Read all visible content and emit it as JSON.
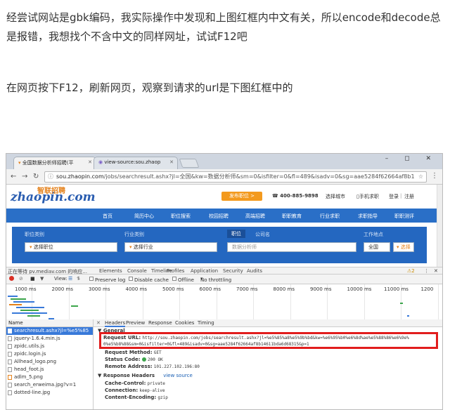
{
  "article": {
    "para1": "经尝试网站是gbk编码，我实际操作中发现和上图红框内中文有关，所以encode和decode总是报错，我想找个不含中文的同样网址，试试F12吧",
    "para2": "在网页按下F12，刷新网页，观察到请求的url是下图红框中的"
  },
  "browser": {
    "tab1": "全国数据分析师招聘(平",
    "tab2": "view-source:sou.zhaop",
    "url_host": "sou.zhaopin.com",
    "url_path": "/jobs/searchresult.ashx?jl=全国&kw=数据分析师&sm=0&isfilter=0&fl=489&isadv=0&sg=aae5284f62664af8b1",
    "win_buttons": "– ◻ ✕"
  },
  "site": {
    "logo_main": "zhaopin.com",
    "logo_sub": "智联招聘",
    "publish_btn": "发布职位 >",
    "phone": "☎ 400-885-9898",
    "city_select": "选择城市",
    "mobile": "▯手机求职",
    "login": "登录",
    "register": "注册",
    "nav": [
      "首页",
      "简历中心",
      "职位搜索",
      "校园招聘",
      "高端招聘",
      "职职教育",
      "行业求职",
      "求职指导",
      "职职测评"
    ],
    "search": {
      "label_category": "职位类别",
      "label_industry": "行业类别",
      "label_position": "职位",
      "label_company": "公司名",
      "label_location": "工作地点",
      "category_value": "选择职位",
      "industry_value": "选择行业",
      "keyword_placeholder": "数据分析师",
      "location_value": "全国",
      "location_btn": "选择"
    }
  },
  "status_bar": {
    "text": "正在等待 pv.mediav.com 的响应...",
    "devtabs": [
      "Elements",
      "Console",
      "Sources",
      "Network",
      "Timeline",
      "Profiles",
      "Application",
      "Security",
      "Audits"
    ],
    "warnings": "⚠2"
  },
  "devtools": {
    "view_label": "View:",
    "preserve_log": "Preserve log",
    "disable_cache": "Disable cache",
    "offline": "Offline",
    "throttling": "No throttling",
    "ticks": [
      "1000 ms",
      "2000 ms",
      "3000 ms",
      "4000 ms",
      "5000 ms",
      "6000 ms",
      "7000 ms",
      "8000 ms",
      "9000 ms",
      "10000 ms",
      "11000 ms",
      "1200"
    ],
    "name_header": "Name",
    "files": [
      "searchresult.ashx?jl=%e5%85",
      "jquery-1.6.4.min.js",
      "zpidc.utils.js",
      "zpidc.login.js",
      "Allhead_logo.png",
      "head_foot.js",
      "adlm_5.png",
      "search_erweima.jpg?v=1",
      "dotted-line.jpg"
    ],
    "detail_tabs": [
      "Headers",
      "Preview",
      "Response",
      "Cookies",
      "Timing"
    ],
    "general": "▼ General",
    "request_url_label": "Request URL:",
    "request_url_1": "http://sou.zhaopin.com/jobs/searchresult.ashx?jl=%e5%85%a8%e5%9b%bd&kw=%e6%95%b0%e6%8d%ae%e5%88%86%e6%9e%",
    "request_url_2": "0%e5%b8%88&sm=0&isfilter=0&fl=489&isadv=0&sg=aae5284f62664af8b14611bda6d68315&p=1",
    "method_label": "Request Method:",
    "method": "GET",
    "status_label": "Status Code:",
    "status": "200 OK",
    "remote_label": "Remote Address:",
    "remote": "101.227.102.196:80",
    "resp_headers": "▼ Response Headers",
    "view_source": "view source",
    "cc_label": "Cache-Control:",
    "cc": "private",
    "conn_label": "Connection:",
    "conn": "keep-alive",
    "ce_label": "Content-Encoding:",
    "ce": "gzip"
  },
  "colors": {
    "accent_red": "#e11d1d",
    "site_blue": "#2a6fc7",
    "site_orange": "#f39a1e"
  }
}
